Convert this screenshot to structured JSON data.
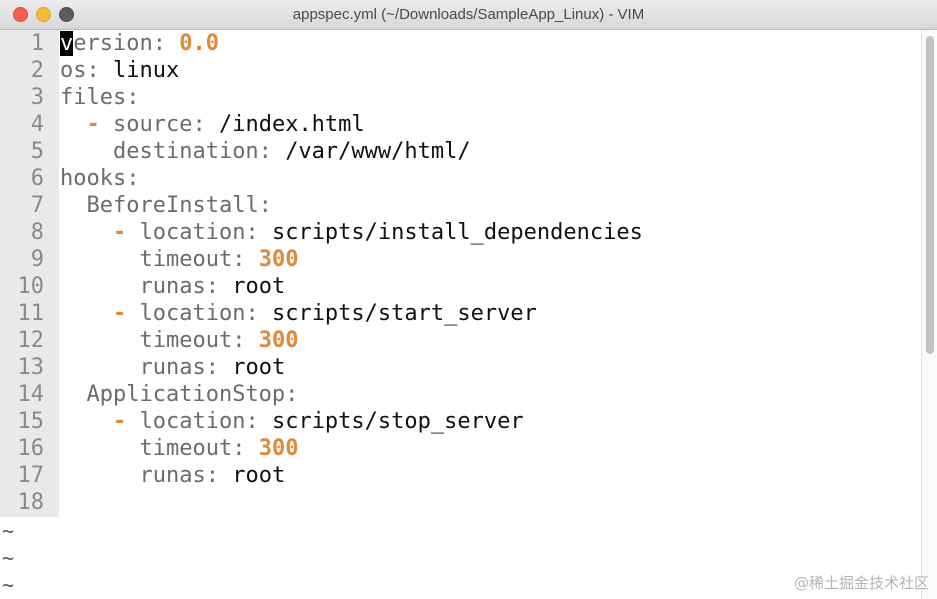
{
  "window": {
    "title": "appspec.yml (~/Downloads/SampleApp_Linux) - VIM"
  },
  "editor": {
    "cursor_line": 1,
    "lines": [
      {
        "num": "1",
        "indent": "",
        "dash": false,
        "key": "version:",
        "value": "0.0",
        "value_type": "num"
      },
      {
        "num": "2",
        "indent": "",
        "dash": false,
        "key": "os:",
        "value": "linux",
        "value_type": "str"
      },
      {
        "num": "3",
        "indent": "",
        "dash": false,
        "key": "files:",
        "value": "",
        "value_type": "str"
      },
      {
        "num": "4",
        "indent": "  ",
        "dash": true,
        "key": "source:",
        "value": "/index.html",
        "value_type": "str"
      },
      {
        "num": "5",
        "indent": "    ",
        "dash": false,
        "key": "destination:",
        "value": "/var/www/html/",
        "value_type": "str"
      },
      {
        "num": "6",
        "indent": "",
        "dash": false,
        "key": "hooks:",
        "value": "",
        "value_type": "str"
      },
      {
        "num": "7",
        "indent": "  ",
        "dash": false,
        "key": "BeforeInstall:",
        "value": "",
        "value_type": "str"
      },
      {
        "num": "8",
        "indent": "    ",
        "dash": true,
        "key": "location:",
        "value": "scripts/install_dependencies",
        "value_type": "str"
      },
      {
        "num": "9",
        "indent": "      ",
        "dash": false,
        "key": "timeout:",
        "value": "300",
        "value_type": "num"
      },
      {
        "num": "10",
        "indent": "      ",
        "dash": false,
        "key": "runas:",
        "value": "root",
        "value_type": "str"
      },
      {
        "num": "11",
        "indent": "    ",
        "dash": true,
        "key": "location:",
        "value": "scripts/start_server",
        "value_type": "str"
      },
      {
        "num": "12",
        "indent": "      ",
        "dash": false,
        "key": "timeout:",
        "value": "300",
        "value_type": "num"
      },
      {
        "num": "13",
        "indent": "      ",
        "dash": false,
        "key": "runas:",
        "value": "root",
        "value_type": "str"
      },
      {
        "num": "14",
        "indent": "  ",
        "dash": false,
        "key": "ApplicationStop:",
        "value": "",
        "value_type": "str"
      },
      {
        "num": "15",
        "indent": "    ",
        "dash": true,
        "key": "location:",
        "value": "scripts/stop_server",
        "value_type": "str"
      },
      {
        "num": "16",
        "indent": "      ",
        "dash": false,
        "key": "timeout:",
        "value": "300",
        "value_type": "num"
      },
      {
        "num": "17",
        "indent": "      ",
        "dash": false,
        "key": "runas:",
        "value": "root",
        "value_type": "str"
      },
      {
        "num": "18",
        "indent": "",
        "dash": false,
        "key": "",
        "value": "",
        "value_type": "str"
      }
    ],
    "empty_marker": "~",
    "empty_line_count": 3
  },
  "watermark": "@稀土掘金技术社区"
}
